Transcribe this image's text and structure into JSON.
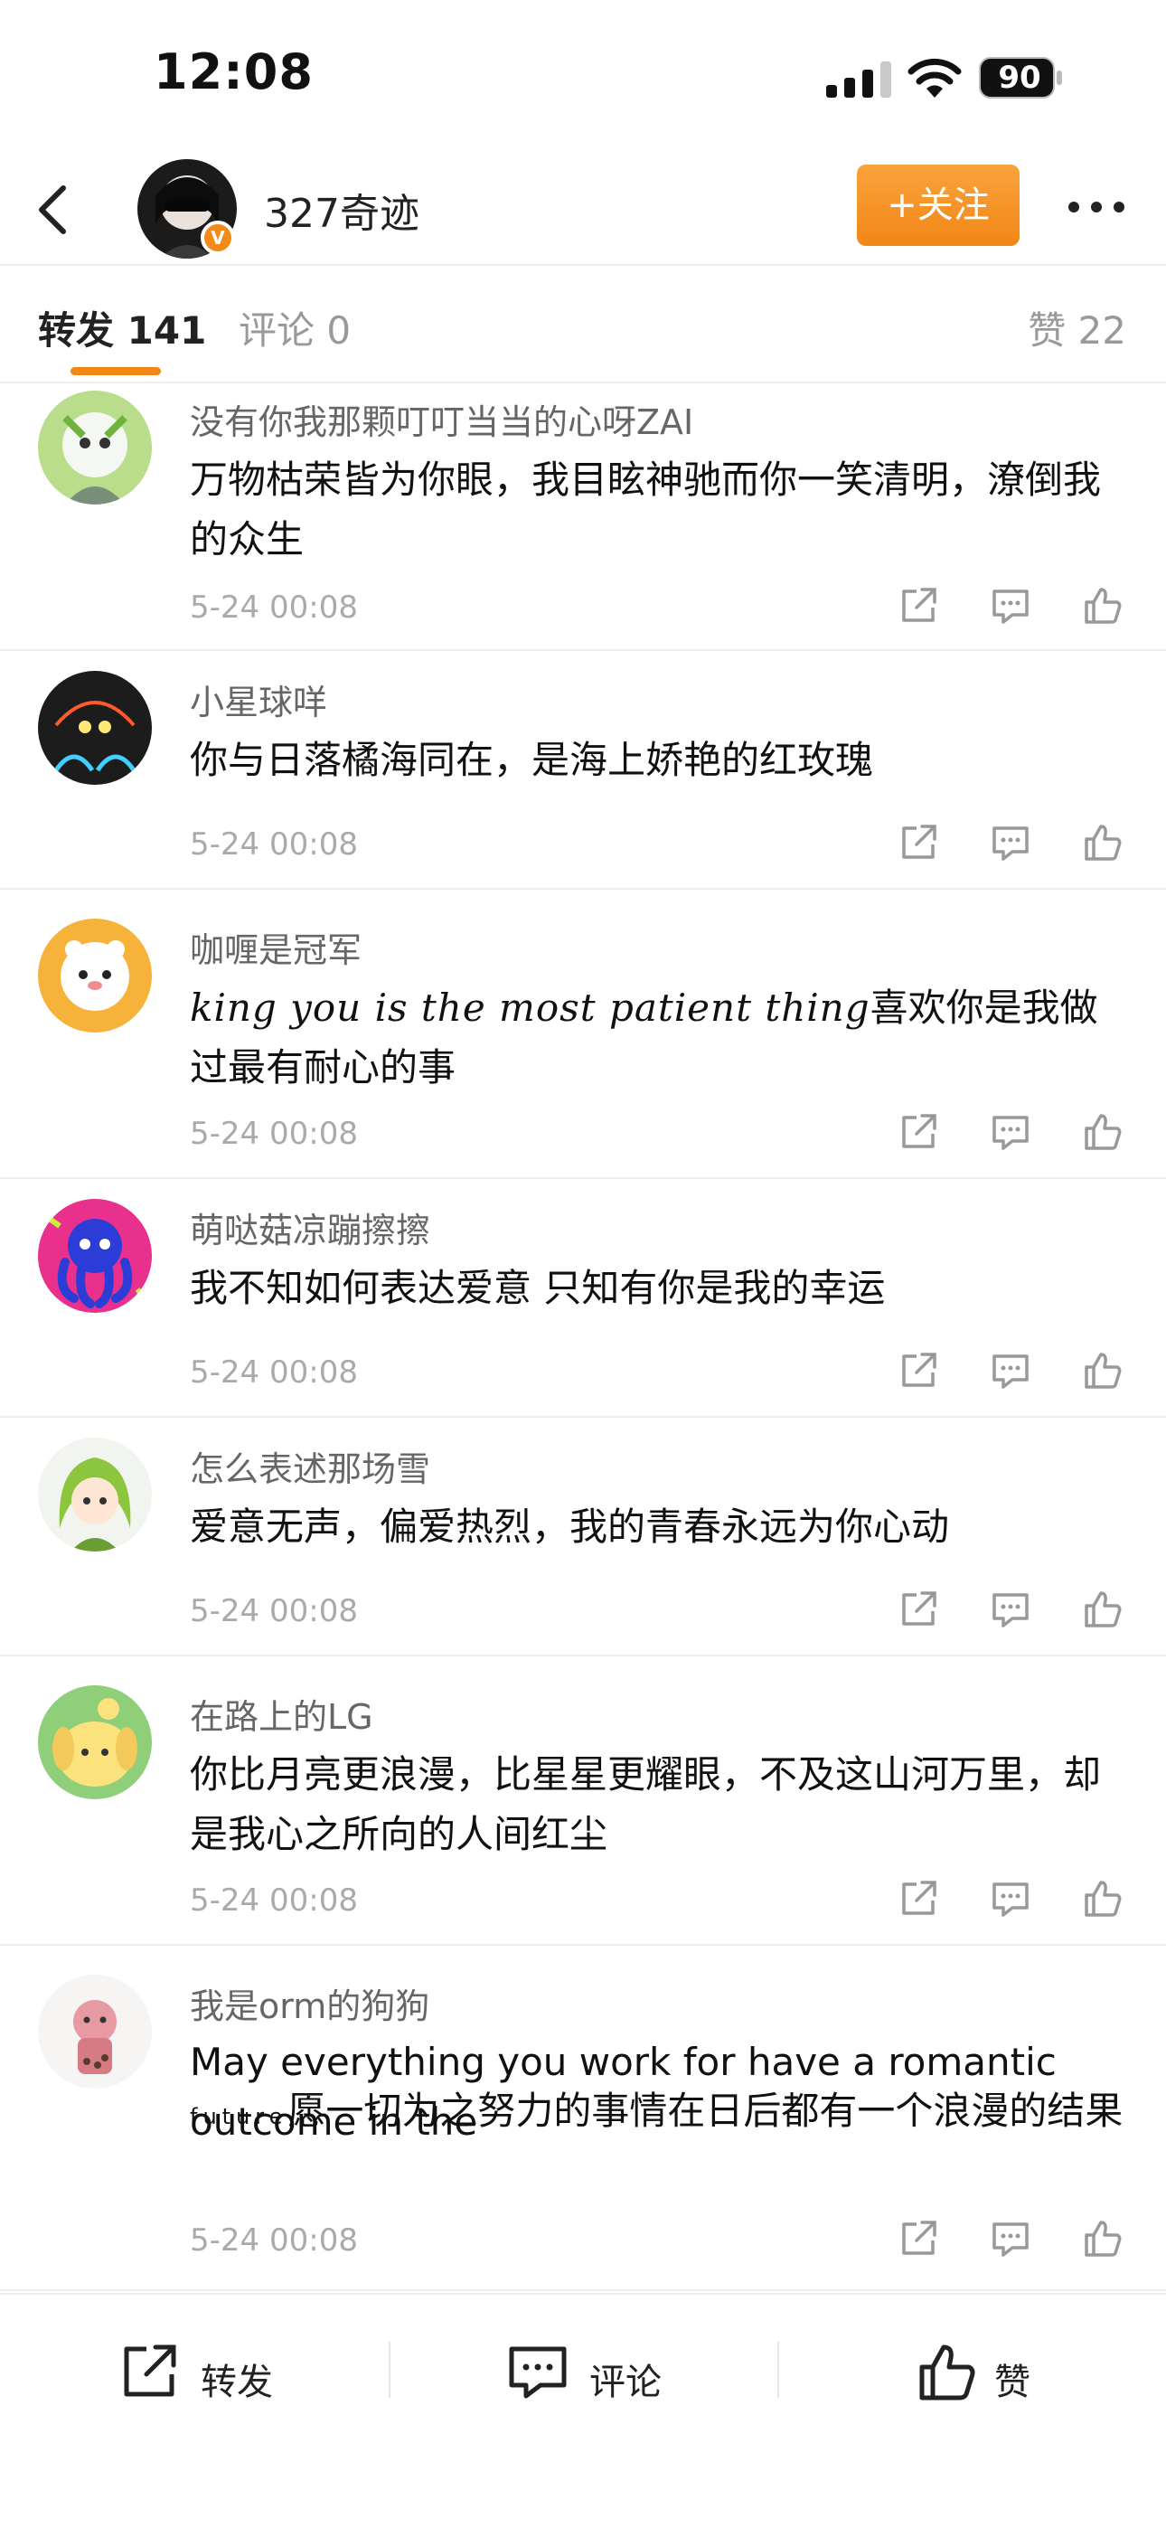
{
  "status": {
    "time": "12:08",
    "battery": "90"
  },
  "header": {
    "name": "327奇迹",
    "follow_label": "+关注"
  },
  "tabs": {
    "repost": "转发 141",
    "comment": "评论 0",
    "like": "赞 22"
  },
  "items": [
    {
      "name": "没有你我那颗叮叮当当的心呀ZAI",
      "text": "万物枯荣皆为你眼，我目眩神驰而你一笑清明，潦倒我的众生",
      "date": "5-24 00:08"
    },
    {
      "name": "小星球咩",
      "text": "你与日落橘海同在，是海上娇艳的红玫瑰",
      "date": "5-24 00:08"
    },
    {
      "name": "咖喱是冠军",
      "text_script": "king you is the most patient thing",
      "text": "喜欢你是我做过最有耐心的事",
      "date": "5-24 00:08"
    },
    {
      "name": "萌哒菇凉蹦擦擦",
      "text": "我不知如何表达爱意 只知有你是我的幸运",
      "date": "5-24 00:08"
    },
    {
      "name": "怎么表述那场雪",
      "text": "爱意无声，偏爱热烈，我的青春永远为你心动",
      "date": "5-24 00:08"
    },
    {
      "name": "在路上的LG",
      "text": "你比月亮更浪漫，比星星更耀眼，不及这山河万里，却是我心之所向的人间红尘",
      "date": "5-24 00:08"
    },
    {
      "name": "我是orm的狗狗",
      "text_en": "May everything you work for have a romantic outcome in the",
      "text_en_tail": "future",
      "text": "愿一切为之努力的事情在日后都有一个浪漫的结果",
      "date": "5-24 00:08"
    }
  ],
  "bottom": {
    "repost": "转发",
    "comment": "评论",
    "like": "赞"
  },
  "colors": {
    "accent": "#f28617"
  },
  "icons": [
    "back-arrow-icon",
    "more-icon",
    "share-icon",
    "comment-icon",
    "like-icon"
  ]
}
